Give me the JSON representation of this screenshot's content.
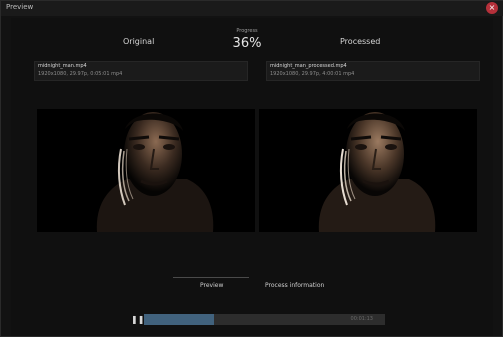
{
  "window": {
    "title": "Preview",
    "close_glyph": "×"
  },
  "header": {
    "original_label": "Original",
    "processed_label": "Processed",
    "progress_caption": "Progress",
    "progress_value": "36%"
  },
  "files": {
    "original": {
      "name": "midnight_man.mp4",
      "info": "1920x1080, 29.97p, 0:05:01 mp4"
    },
    "processed": {
      "name": "midnight_man_processed.mp4",
      "info": "1920x1080, 29.97p, 4:00:01 mp4"
    }
  },
  "tabs": {
    "preview": "Preview",
    "process": "Process information"
  },
  "playback": {
    "play_glyph": "❚❚",
    "progress_fraction": 0.29,
    "time_label": "00:01:13"
  },
  "colors": {
    "accent": "#41627d",
    "close": "#b5303a"
  }
}
